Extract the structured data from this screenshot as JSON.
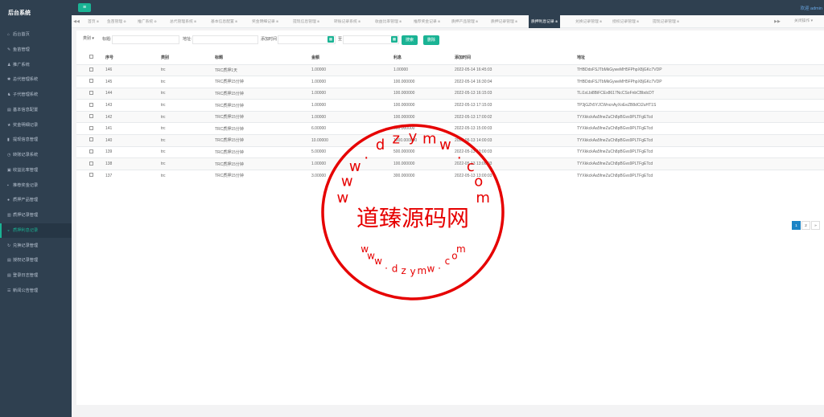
{
  "brand": "后台系统",
  "topbar": {
    "menu_icon": "hamburger-icon",
    "welcome": "欢迎 admin"
  },
  "sidebar": {
    "items": [
      {
        "label": "后台首页",
        "icon": "home-icon"
      },
      {
        "label": "鱼苗管理",
        "icon": "wrench-icon"
      },
      {
        "label": "推广系统",
        "icon": "user-icon"
      },
      {
        "label": "总代管理系统",
        "icon": "snowflake-icon"
      },
      {
        "label": "子代管理系统",
        "icon": "users-icon"
      },
      {
        "label": "基本信息配置",
        "icon": "file-icon"
      },
      {
        "label": "奖金明细记录",
        "icon": "star-icon"
      },
      {
        "label": "提现信息管理",
        "icon": "bookmark-icon"
      },
      {
        "label": "转账记录系统",
        "icon": "clock-icon"
      },
      {
        "label": "收益比率管理",
        "icon": "camera-icon"
      },
      {
        "label": "推荐奖金记录",
        "icon": "gift-icon"
      },
      {
        "label": "质押产品管理",
        "icon": "comment-icon"
      },
      {
        "label": "质押记录管理",
        "icon": "bar-chart-icon"
      },
      {
        "label": "质押利息记录",
        "icon": "magnet-icon"
      },
      {
        "label": "兑换记录管理",
        "icon": "refresh-icon"
      },
      {
        "label": "授权记录管理",
        "icon": "file-icon"
      },
      {
        "label": "登录日志管理",
        "icon": "file-text-icon"
      },
      {
        "label": "新闻公告管理",
        "icon": "list-icon"
      }
    ],
    "active_index": 13
  },
  "tabs": {
    "items": [
      "首页",
      "鱼苗管理",
      "推广系统",
      "总代管理系统",
      "基本信息配置",
      "奖金明细记录",
      "提现信息管理",
      "转账记录系统",
      "收益比率管理",
      "推荐奖金记录",
      "质押产品管理",
      "质押记录管理",
      "质押利息记录",
      "兑换记录管理",
      "授权记录管理",
      "提现记录管理"
    ],
    "active_index": 12,
    "close_label": "关闭操作"
  },
  "search": {
    "type_label": "类别",
    "title_label": "标题:",
    "address_label": "地址:",
    "time_label": "添加时间",
    "to_label": "至",
    "search_button": "搜索",
    "delete_button": "删除"
  },
  "table": {
    "columns": [
      "序号",
      "类别",
      "标题",
      "金额",
      "利息",
      "添加时间",
      "地址"
    ],
    "rows": [
      {
        "id": "146",
        "type": "trc",
        "title": "TRC质押1天",
        "amount": "1.00000",
        "interest": "1.00000",
        "time": "2022-05-14 16:45:03",
        "address": "THBDdsFSJTbMkGyweMH5FPhpX8jGKc7VDP"
      },
      {
        "id": "145",
        "type": "trc",
        "title": "TRC质押15分钟",
        "amount": "1.00000",
        "interest": "100.000000",
        "time": "2022-05-14 16:30:04",
        "address": "THBDdsFSJTbMkGyweMH5FPhpX8jGKc7VDP"
      },
      {
        "id": "144",
        "type": "trc",
        "title": "TRC质押15分钟",
        "amount": "1.00000",
        "interest": "100.000000",
        "time": "2022-05-13 16:15:03",
        "address": "TLi1xLbi8BiFCEx8617NcCSoFnbCBbdcDT"
      },
      {
        "id": "143",
        "type": "trc",
        "title": "TRC质押15分钟",
        "amount": "1.00000",
        "interest": "100.000000",
        "time": "2022-05-13 17:15:03",
        "address": "TP3jGZh5YJCWncnAyXoEeZB8dCt2uHT1S"
      },
      {
        "id": "142",
        "type": "trc",
        "title": "TRC质押15分钟",
        "amount": "1.00000",
        "interest": "100.000000",
        "time": "2022-05-13 17:00:02",
        "address": "TYXkkckAa5fneZuCh8pBGvs9PLTFgETcd"
      },
      {
        "id": "141",
        "type": "trc",
        "title": "TRC质押15分钟",
        "amount": "6.00000",
        "interest": "600.000000",
        "time": "2022-05-13 15:00:03",
        "address": "TYXkkckAa5fneZuCh8pBGvs9PLTFgETcd"
      },
      {
        "id": "140",
        "type": "trc",
        "title": "TRC质押15分钟",
        "amount": "10.00000",
        "interest": "1000.000000",
        "time": "2022-05-13 14:00:03",
        "address": "TYXkkckAa5fneZuCh8pBGvs9PLTFgETcd"
      },
      {
        "id": "139",
        "type": "trc",
        "title": "TRC质押15分钟",
        "amount": "5.00000",
        "interest": "500.000000",
        "time": "2022-05-13 13:00:03",
        "address": "TYXkkckAa5fneZuCh8pBGvs9PLTFgETcd"
      },
      {
        "id": "138",
        "type": "trc",
        "title": "TRC质押15分钟",
        "amount": "1.00000",
        "interest": "100.000000",
        "time": "2022-05-13 13:00:03",
        "address": "TYXkkckAa5fneZuCh8pBGvs9PLTFgETcd"
      },
      {
        "id": "137",
        "type": "trc",
        "title": "TRC质押15分钟",
        "amount": "3.00000",
        "interest": "300.000000",
        "time": "2022-05-13 13:00:03",
        "address": "TYXkkckAa5fneZuCh8pBGvs9PLTFgETcd"
      }
    ]
  },
  "pagination": {
    "pages": [
      "1",
      "2",
      "»"
    ],
    "active": "1"
  },
  "watermark": {
    "text": "道臻源码网",
    "url_top": "www.dzymw.com",
    "url_bottom": "www.dzymw.com",
    "color": "#e60000"
  },
  "colors": {
    "sidebar": "#2f4050",
    "accent": "#1ab394",
    "page_active": "#1c84c6"
  }
}
